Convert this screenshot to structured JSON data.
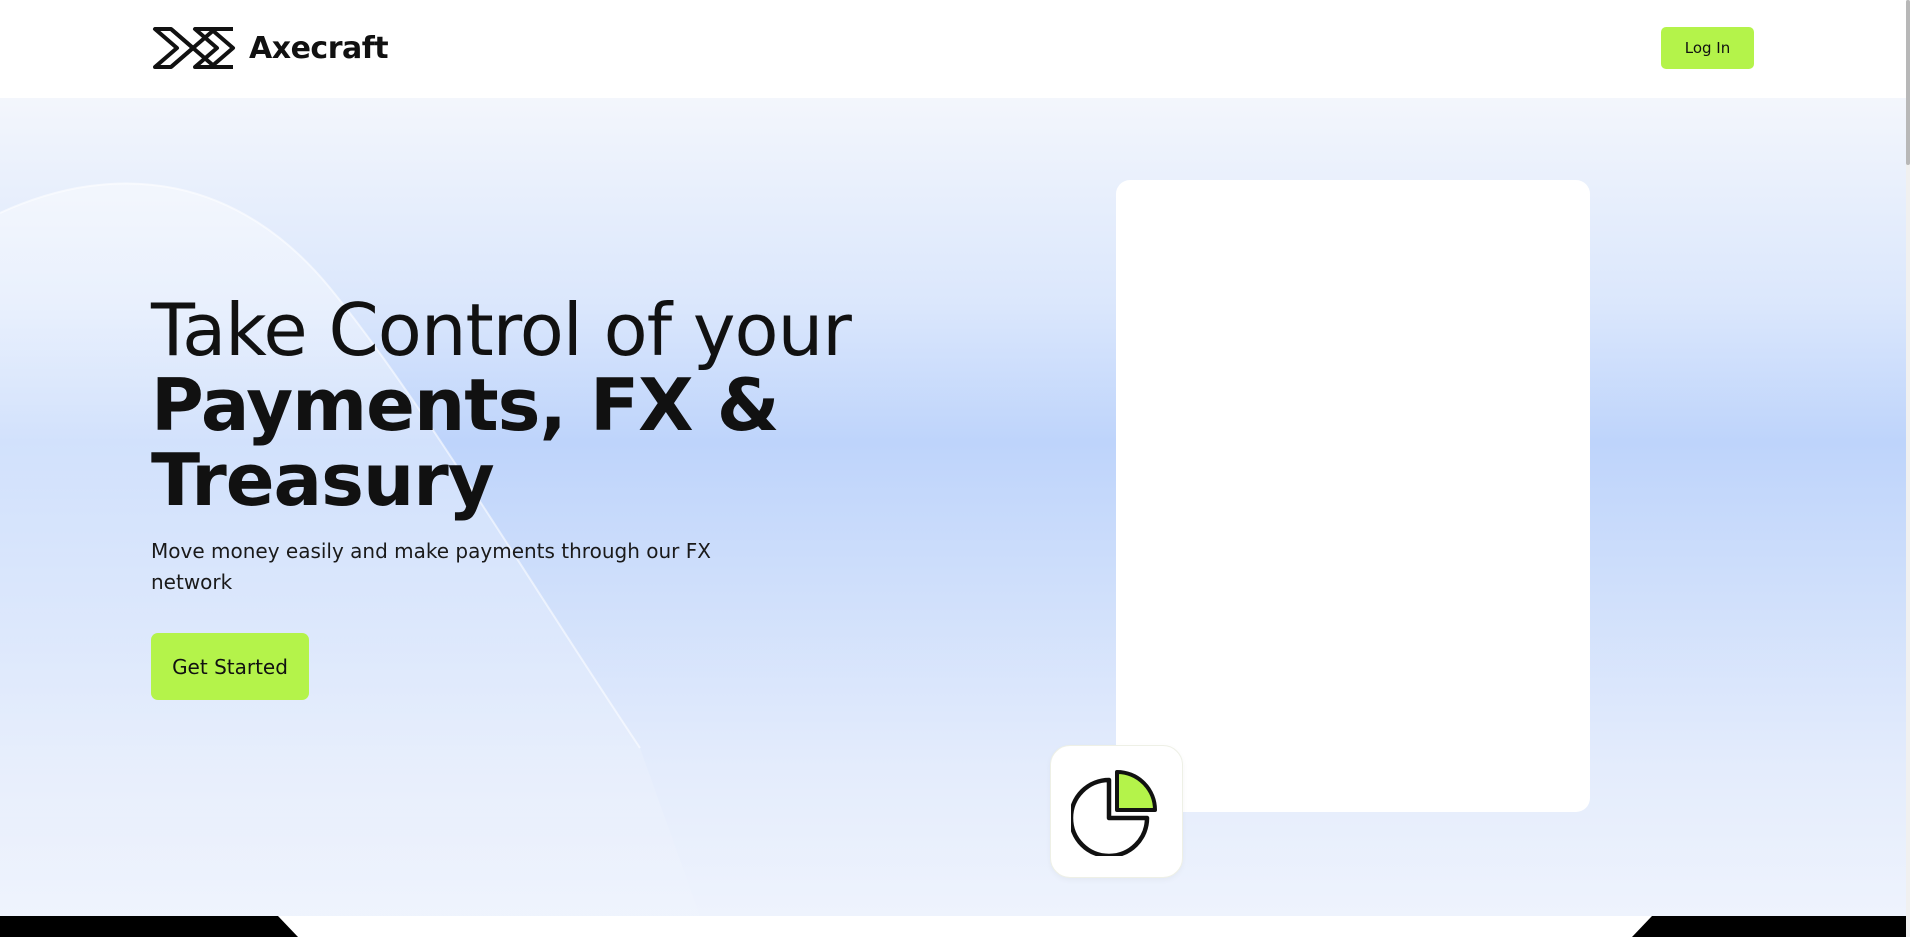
{
  "header": {
    "brand_name": "Axecraft",
    "logo_icon": "axecraft-logo-icon",
    "login_label": "Log In"
  },
  "hero": {
    "headline_line1": "Take Control of your",
    "headline_line2": "Payments, FX &",
    "headline_line3": "Treasury",
    "subtext": "Move money easily and make payments through our FX network",
    "cta_label": "Get Started",
    "feature_icon": "pie-chart-icon"
  },
  "colors": {
    "accent": "#b4f34a",
    "text": "#111111",
    "hero_bg": "#bed4fb",
    "card": "#ffffff",
    "footer_dark": "#000000"
  }
}
